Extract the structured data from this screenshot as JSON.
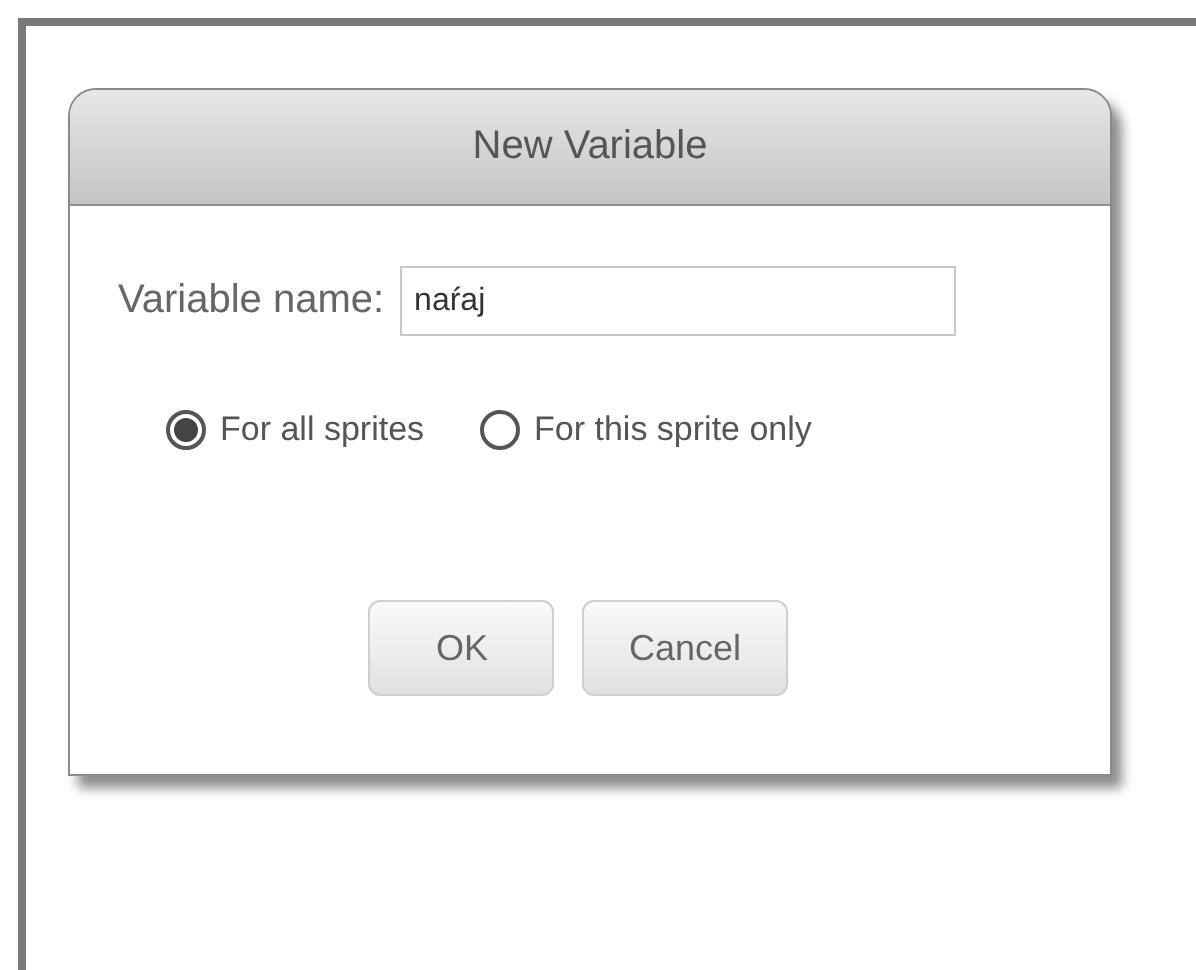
{
  "dialog": {
    "title": "New Variable",
    "name_label": "Variable name:",
    "name_value": "naŕaj",
    "scope_options": [
      {
        "label": "For all sprites",
        "selected": true
      },
      {
        "label": "For this sprite only",
        "selected": false
      }
    ],
    "buttons": [
      "OK",
      "Cancel"
    ]
  }
}
